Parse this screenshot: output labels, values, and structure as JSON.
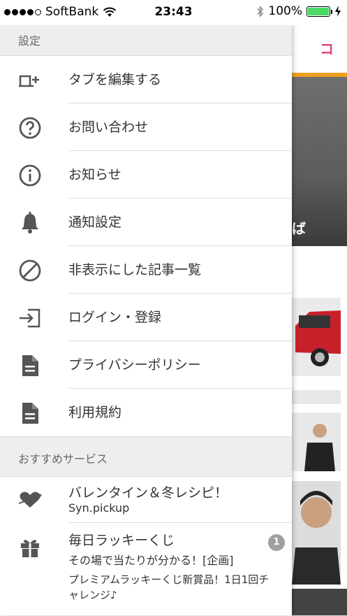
{
  "status_bar": {
    "carrier": "SoftBank",
    "time": "23:43",
    "battery": "100%"
  },
  "background": {
    "header_text": "コラ",
    "video_caption": "ば",
    "accent_color": "#f0a020",
    "header_color": "#e0407a"
  },
  "drawer": {
    "settings_header": "設定",
    "settings_items": [
      {
        "label": "タブを編集する",
        "icon": "tab-add-icon"
      },
      {
        "label": "お問い合わせ",
        "icon": "help-circle-icon"
      },
      {
        "label": "お知らせ",
        "icon": "info-circle-icon"
      },
      {
        "label": "通知設定",
        "icon": "bell-icon"
      },
      {
        "label": "非表示にした記事一覧",
        "icon": "block-icon"
      },
      {
        "label": "ログイン・登録",
        "icon": "login-icon"
      },
      {
        "label": "プライバシーポリシー",
        "icon": "document-icon"
      },
      {
        "label": "利用規約",
        "icon": "document-icon"
      }
    ],
    "services_header": "おすすめサービス",
    "services": [
      {
        "title": "バレンタイン＆冬レシピ！",
        "subtitle": "Syn.pickup",
        "icon": "heart-arrow-icon"
      },
      {
        "title": "毎日ラッキーくじ",
        "subtitle": "その場で当たりが分かる！[企画]",
        "description_line1": "プレミアムラッキーくじ新賞品！1日1回チ",
        "description_line2": "ャレンジ♪",
        "badge": "1",
        "icon": "gift-icon"
      }
    ]
  }
}
